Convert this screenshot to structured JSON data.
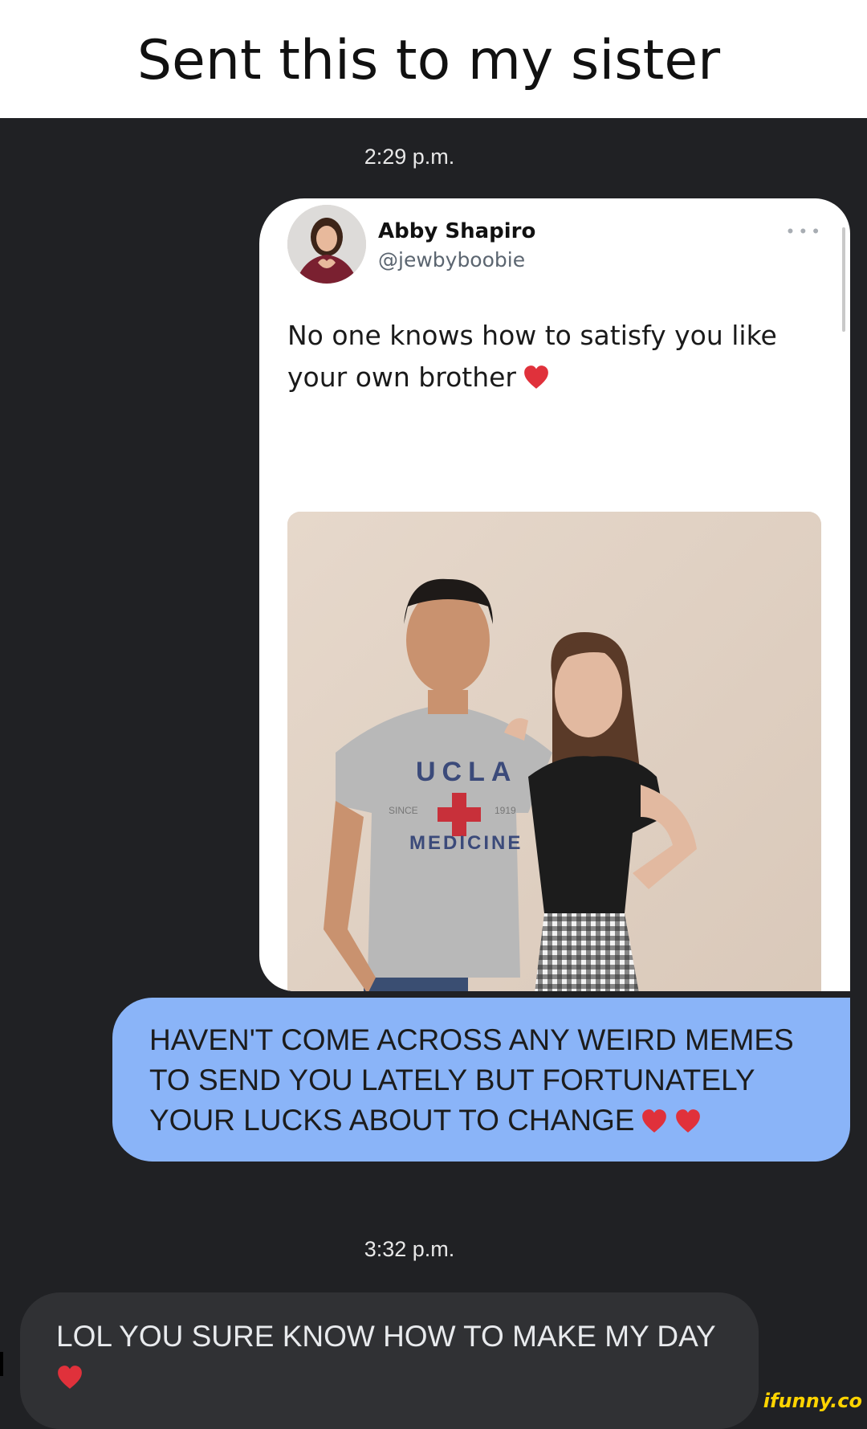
{
  "caption": {
    "text": "Sent this to my sister"
  },
  "chat": {
    "timestamp_1": "2:29 p.m.",
    "timestamp_2": "3:32 p.m.",
    "tweet": {
      "display_name": "Abby Shapiro",
      "handle": "@jewbyboobie",
      "text": "No one knows how to satisfy you like your own brother",
      "emoji": "heart-icon",
      "photo_shirt_text": [
        "UCLA",
        "SINCE",
        "1919",
        "MEDICINE"
      ]
    },
    "outgoing_message": "HAVEN'T COME ACROSS ANY WEIRD MEMES TO SEND YOU LATELY BUT FORTUNATELY YOUR LUCKS ABOUT TO CHANGE",
    "incoming_message": "LOL YOU SURE KNOW HOW TO MAKE MY DAY"
  },
  "watermark": "ifunny.co",
  "colors": {
    "chat_bg": "#202124",
    "outgoing_bubble": "#8ab4f8",
    "incoming_bubble": "#303134",
    "heart": "#e0313b"
  }
}
